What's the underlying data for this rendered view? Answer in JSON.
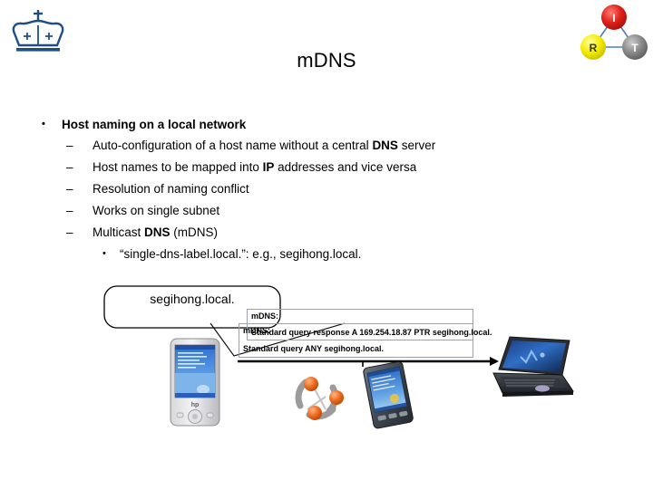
{
  "slide": {
    "title": "mDNS"
  },
  "logo": {
    "name": "columbia-crown-logo",
    "color": "#1f4e86"
  },
  "badge": {
    "nodes": [
      {
        "id": "I",
        "label": "I",
        "color": "#e0201b"
      },
      {
        "id": "R",
        "label": "R",
        "color": "#f5ec00"
      },
      {
        "id": "T",
        "label": "T",
        "color": "#8a8a8a"
      }
    ],
    "edge_color": "#4a7ebb"
  },
  "bullets": {
    "level1": {
      "marker": "•",
      "text": "Host naming on a local network"
    },
    "level2": [
      {
        "marker": "–",
        "text": "Auto-configuration of a host name without a central DNS server"
      },
      {
        "marker": "–",
        "text": "Host names to be mapped into IP addresses and vice versa"
      },
      {
        "marker": "–",
        "text": "Resolution of naming conflict"
      },
      {
        "marker": "–",
        "text": "Works on single subnet"
      },
      {
        "marker": "–",
        "text": "Multicast DNS (mDNS)"
      }
    ],
    "level3": [
      {
        "marker": "•",
        "text": "“single-dns-label.local.”: e.g., segihong.local."
      }
    ]
  },
  "diagram": {
    "callout": {
      "text": "segihong.local."
    },
    "packets": [
      {
        "name": "mdns-response",
        "label": "mDNS:",
        "body": "Standard query response A 169.254.18.87 PTR segihong.local."
      },
      {
        "name": "mdns-query",
        "label": "mDNS:",
        "body": "Standard query ANY segihong.local."
      }
    ],
    "devices": [
      {
        "name": "ipaq-pda",
        "caption": ""
      },
      {
        "name": "network-cloud",
        "caption": ""
      },
      {
        "name": "tablet-pda",
        "caption": ""
      },
      {
        "name": "vaio-laptop",
        "caption": ""
      }
    ]
  }
}
